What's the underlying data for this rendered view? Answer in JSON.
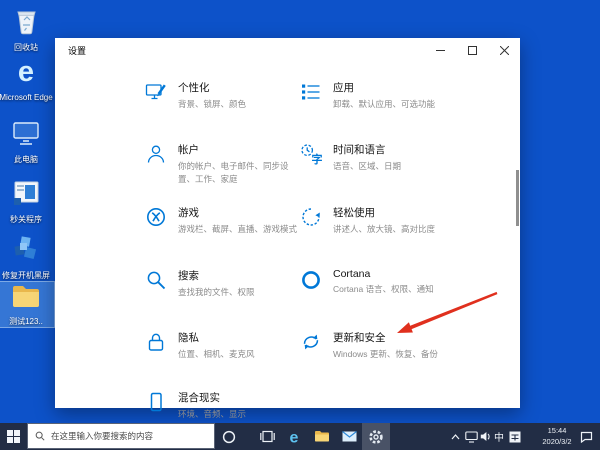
{
  "colors": {
    "accent": "#0078d7",
    "desktop_background": "#0d52c9",
    "taskbar_background": "#222d45",
    "arrow": "#e0301e"
  },
  "desktop": {
    "icons": [
      {
        "id": "recycle-bin",
        "label": "回收站"
      },
      {
        "id": "microsoft-edge",
        "label": "Microsoft Edge"
      },
      {
        "id": "this-pc",
        "label": "此电脑"
      },
      {
        "id": "quick-close-app",
        "label": "秒关程序"
      },
      {
        "id": "fix-boot-black-screen",
        "label": "修复开机黑屏"
      },
      {
        "id": "test-folder",
        "label": "测试123..",
        "selected": "true"
      }
    ]
  },
  "window": {
    "title": "设置",
    "categories": [
      {
        "icon": "personalization-icon",
        "title": "个性化",
        "subtitle": "背景、锁屏、颜色"
      },
      {
        "icon": "apps-icon",
        "title": "应用",
        "subtitle": "卸载、默认应用、可选功能"
      },
      {
        "icon": "accounts-icon",
        "title": "帐户",
        "subtitle": "你的帐户、电子邮件、同步设置、工作、家庭"
      },
      {
        "icon": "time-language-icon",
        "title": "时间和语言",
        "subtitle": "语音、区域、日期"
      },
      {
        "icon": "gaming-icon",
        "title": "游戏",
        "subtitle": "游戏栏、截屏、直播、游戏模式"
      },
      {
        "icon": "ease-of-access-icon",
        "title": "轻松使用",
        "subtitle": "讲述人、放大镜、高对比度"
      },
      {
        "icon": "search-icon",
        "title": "搜索",
        "subtitle": "查找我的文件、权限"
      },
      {
        "icon": "cortana-icon",
        "title": "Cortana",
        "subtitle": "Cortana 语言、权限、通知"
      },
      {
        "icon": "privacy-icon",
        "title": "隐私",
        "subtitle": "位置、相机、麦克风"
      },
      {
        "icon": "update-security-icon",
        "title": "更新和安全",
        "subtitle": "Windows 更新、恢复、备份"
      },
      {
        "icon": "mixed-reality-icon",
        "title": "混合现实",
        "subtitle": "环境、音频、显示"
      }
    ]
  },
  "taskbar": {
    "search_text": "在这里输入你要搜索的内容",
    "ime_mode": "中",
    "clock": {
      "time": "15:44",
      "date": "2020/3/2"
    }
  }
}
